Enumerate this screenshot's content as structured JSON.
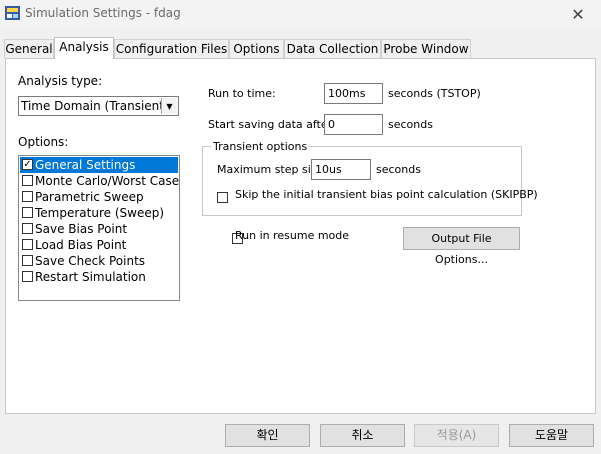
{
  "window": {
    "title": "Simulation Settings - fdag",
    "close_glyph": "✕"
  },
  "tabs": [
    {
      "label": "General"
    },
    {
      "label": "Analysis"
    },
    {
      "label": "Configuration Files"
    },
    {
      "label": "Options"
    },
    {
      "label": "Data Collection"
    },
    {
      "label": "Probe Window"
    }
  ],
  "active_tab": "Analysis",
  "analysis": {
    "type_label": "Analysis type:",
    "type_value": "Time Domain (Transient)",
    "options_label": "Options:",
    "options": [
      {
        "label": "General Settings",
        "checked": true,
        "selected": true
      },
      {
        "label": "Monte Carlo/Worst Case",
        "checked": false
      },
      {
        "label": "Parametric Sweep",
        "checked": false
      },
      {
        "label": "Temperature (Sweep)",
        "checked": false
      },
      {
        "label": "Save Bias Point",
        "checked": false
      },
      {
        "label": "Load Bias Point",
        "checked": false
      },
      {
        "label": "Save Check Points",
        "checked": false
      },
      {
        "label": "Restart Simulation",
        "checked": false
      }
    ],
    "run_to_label": "Run to time:",
    "run_to_value": "100ms",
    "run_to_unit": "seconds  (TSTOP)",
    "start_saving_label": "Start saving data after:",
    "start_saving_value": "0",
    "start_saving_unit": "seconds",
    "transient_title": "Transient options",
    "max_step_label": "Maximum step size:",
    "max_step_value": "10us",
    "max_step_unit": "seconds",
    "skip_label": "Skip the initial transient bias point calculation  (SKIPBP)",
    "resume_label": "Run in resume mode",
    "output_button": "Output File Options..."
  },
  "buttons": {
    "ok": "확인",
    "cancel": "취소",
    "apply": "적용(A)",
    "help": "도움말"
  }
}
